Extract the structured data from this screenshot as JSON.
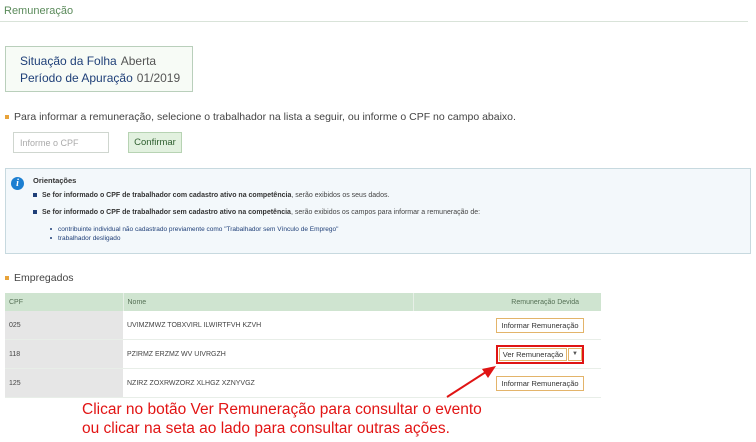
{
  "page": {
    "title": "Remuneração"
  },
  "status": {
    "situacao_label": "Situação da Folha",
    "situacao_value": "Aberta",
    "periodo_label": "Período de Apuração",
    "periodo_value": "01/2019"
  },
  "instruction": "Para informar a remuneração, selecione o trabalhador na lista a seguir, ou informe o CPF no campo abaixo.",
  "cpf_input": {
    "placeholder": "Informe o CPF",
    "value": ""
  },
  "confirm_label": "Confirmar",
  "orientacoes": {
    "title": "Orientações",
    "line1_bold": "Se for informado o CPF de trabalhador com cadastro ativo na competência",
    "line1_rest": ", serão exibidos os seus dados.",
    "line2_bold": "Se for informado o CPF de trabalhador sem cadastro ativo na competência",
    "line2_rest": ", serão exibidos os campos para informar a remuneração de:",
    "sub1": "contribuinte individual não cadastrado previamente como \"Trabalhador sem Vínculo de Emprego\"",
    "sub2": "trabalhador desligado"
  },
  "empregados": {
    "title": "Empregados",
    "headers": {
      "cpf": "CPF",
      "nome": "Nome",
      "remuneracao": "Remuneração Devida"
    },
    "rows": [
      {
        "cpf": "025",
        "nome": "UVIMZMWZ TOBXVIRL ILWIRTFVH KZVH",
        "action": "Informar Remuneração"
      },
      {
        "cpf": "118",
        "nome": "PZIRMZ ERZMZ WV UIVRGZH",
        "action": "Ver Remuneração"
      },
      {
        "cpf": "125",
        "nome": "NZIRZ ZOXRWZORZ XLHGZ XZNYVGZ",
        "action": "Informar Remuneração"
      }
    ]
  },
  "annotation": {
    "line1": "Clicar no botão Ver Remuneração para consultar o evento",
    "line2": "ou clicar na seta ao lado para consultar outras ações."
  },
  "colors": {
    "accent_red": "#e01414",
    "header_green": "#cfe4d0",
    "button_border": "#e3b46a"
  },
  "icons": {
    "info": "info-circle-icon",
    "caret": "caret-down-icon"
  }
}
